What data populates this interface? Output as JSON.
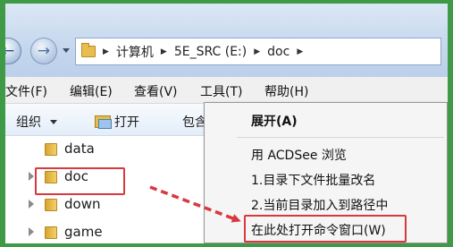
{
  "nav": {
    "back_glyph": "←",
    "forward_glyph": "→"
  },
  "address": {
    "segments": [
      "计算机",
      "5E_SRC (E:)",
      "doc"
    ]
  },
  "menubar": {
    "items": [
      "文件(F)",
      "编辑(E)",
      "查看(V)",
      "工具(T)",
      "帮助(H)"
    ]
  },
  "toolbar": {
    "organize": "组织",
    "open": "打开",
    "include": "包含"
  },
  "tree": {
    "items": [
      {
        "label": "data",
        "expandable": false
      },
      {
        "label": "doc",
        "expandable": true
      },
      {
        "label": "down",
        "expandable": true
      },
      {
        "label": "game",
        "expandable": true
      }
    ]
  },
  "context_menu": {
    "items": [
      {
        "label": "展开(A)",
        "bold": true
      },
      {
        "label": "用 ACDSee 浏览",
        "bold": false
      },
      {
        "label": "1.目录下文件批量改名",
        "bold": false
      },
      {
        "label": "2.当前目录加入到路径中",
        "bold": false
      },
      {
        "label": "在此处打开命令窗口(W)",
        "bold": false
      }
    ]
  },
  "colors": {
    "highlight": "#d8383f",
    "frame": "#3f9a47"
  }
}
